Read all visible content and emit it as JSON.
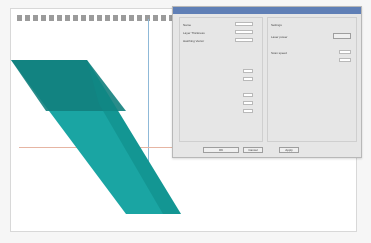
{
  "viewport": {
    "model_color": "#1aa5a3",
    "model_dark": "#0f8f8c"
  },
  "dialog": {
    "title": "",
    "left_fields": [
      {
        "label": "Name"
      },
      {
        "label": "Layer Thickness"
      },
      {
        "label": "Hatching Vector"
      }
    ],
    "right_header": "Settings",
    "right_row1": "Laser power",
    "right_row2": "Scan speed",
    "buttons": [
      "OK",
      "Cancel",
      "Apply"
    ]
  }
}
